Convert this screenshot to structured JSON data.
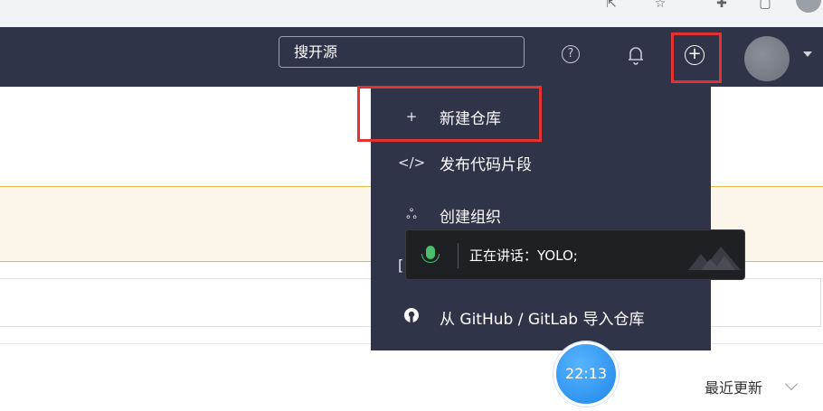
{
  "header": {
    "search_placeholder": "搜开源",
    "help_glyph": "?",
    "plus_glyph": "+"
  },
  "dropdown": {
    "items": [
      {
        "icon": "plus-icon",
        "glyph": "+",
        "label": "新建仓库"
      },
      {
        "icon": "code-icon",
        "glyph": "</>",
        "label": "发布代码片段"
      },
      {
        "icon": "people-icon",
        "glyph": "ஃ",
        "label": "创建组织"
      },
      {
        "icon": "github-icon",
        "glyph": "●",
        "label": "从 GitHub / GitLab 导入仓库"
      }
    ]
  },
  "voice_overlay": {
    "text": "正在讲话：YOLO;"
  },
  "list": {
    "sort_label": "最近更新"
  },
  "clock": {
    "time": "22:13"
  },
  "colors": {
    "header_bg": "#2f3448",
    "highlight": "#e23232",
    "banner_bg": "#fcf6ea",
    "clock_blue": "#1e86e8"
  }
}
